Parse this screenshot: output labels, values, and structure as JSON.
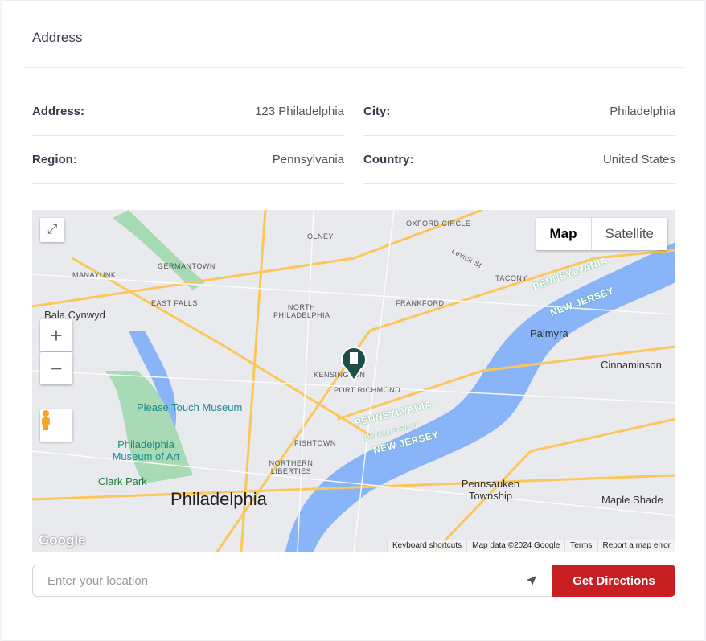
{
  "section_title": "Address",
  "fields": [
    {
      "label": "Address:",
      "value": "123 Philadelphia"
    },
    {
      "label": "City:",
      "value": "Philadelphia"
    },
    {
      "label": "Region:",
      "value": "Pennsylvania"
    },
    {
      "label": "Country:",
      "value": "United States"
    }
  ],
  "map": {
    "type_buttons": [
      "Map",
      "Satellite"
    ],
    "zoom_in": "+",
    "zoom_out": "−",
    "logo": "Google",
    "attribution": [
      "Keyboard shortcuts",
      "Map data ©2024 Google",
      "Terms",
      "Report a map error"
    ],
    "labels": {
      "city": "Philadelphia",
      "places": [
        "OLNEY",
        "OXFORD CIRCLE",
        "GERMANTOWN",
        "MANAYUNK",
        "EAST FALLS",
        "NORTH PHILADELPHIA",
        "FRANKFORD",
        "TACONY",
        "KENSINGTON",
        "PORT RICHMOND",
        "FISHTOWN",
        "NORTHERN LIBERTIES"
      ],
      "towns": [
        "Bala Cynwyd",
        "Palmyra",
        "Cinnaminson",
        "Pennsauken Township",
        "Maple Shade",
        "Clark Park"
      ],
      "water": [
        "PENNSYLVANIA",
        "NEW JERSEY",
        "PENNSYLVANIA",
        "NEW JERSEY",
        "Delaware River"
      ],
      "pois": [
        "Please Touch Museum",
        "Philadelphia Museum of Art"
      ],
      "street": "Levick St"
    }
  },
  "directions": {
    "placeholder": "Enter your location",
    "button": "Get Directions"
  }
}
